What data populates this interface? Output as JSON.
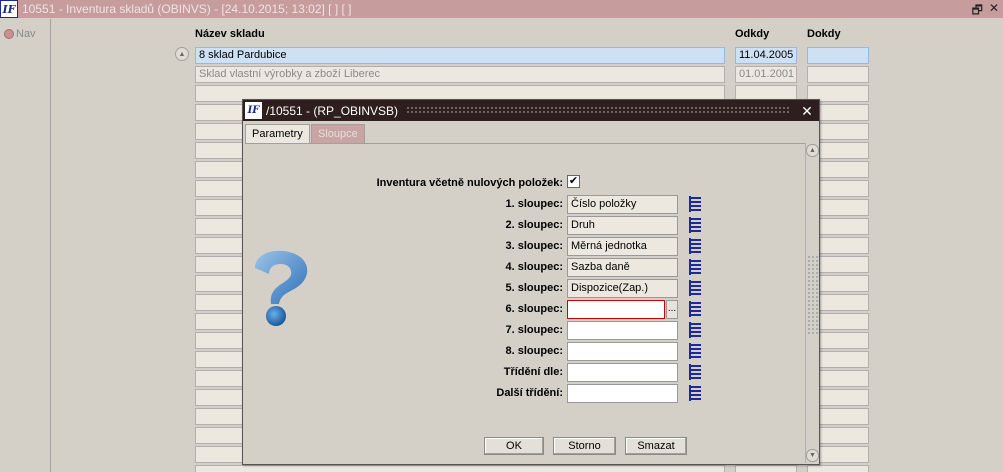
{
  "window": {
    "logo": "IF",
    "title": "10551 - Inventura skladů (OBINVS) - [24.10.2015; 13:02] [ ] [ ]",
    "restore_icon": "🗗",
    "close_icon": "✕"
  },
  "left_panel": {
    "nav_label": "Nav"
  },
  "grid": {
    "headers": {
      "name": "Název skladu",
      "from": "Odkdy",
      "to": "Dokdy"
    },
    "rows": [
      {
        "name": "8  sklad Pardubice",
        "from": "11.04.2005",
        "to": ""
      },
      {
        "name": "Sklad vlastní výrobky a zboží Liberec",
        "from": "01.01.2001",
        "to": ""
      }
    ]
  },
  "dialog": {
    "logo": "IF",
    "title": "/10551 - (RP_OBINVSB)",
    "close_icon": "✕",
    "tabs": [
      {
        "label": "Parametry",
        "active": true
      },
      {
        "label": "Sloupce",
        "active": false
      }
    ],
    "checkbox": {
      "label": "Inventura včetně nulových položek:",
      "checked": true,
      "mark": "✔"
    },
    "fields": [
      {
        "label": "1. sloupec:",
        "value": "Číslo položky"
      },
      {
        "label": "2. sloupec:",
        "value": "Druh"
      },
      {
        "label": "3. sloupec:",
        "value": "Měrná jednotka"
      },
      {
        "label": "4. sloupec:",
        "value": "Sazba daně"
      },
      {
        "label": "5. sloupec:",
        "value": "Dispozice(Zap.)"
      },
      {
        "label": "6. sloupec:",
        "value": ""
      },
      {
        "label": "7. sloupec:",
        "value": ""
      },
      {
        "label": "8. sloupec:",
        "value": ""
      },
      {
        "label": "Třídění dle:",
        "value": ""
      },
      {
        "label": "Další třídění:",
        "value": ""
      }
    ],
    "ellipsis": "...",
    "buttons": {
      "ok": "OK",
      "cancel": "Storno",
      "clear": "Smazat"
    }
  },
  "colors": {
    "titlebar": "#c69c9c",
    "dialog_titlebar": "#2e1e1e",
    "selection": "#cde0f4",
    "list_icon": "#1a2a9a"
  }
}
